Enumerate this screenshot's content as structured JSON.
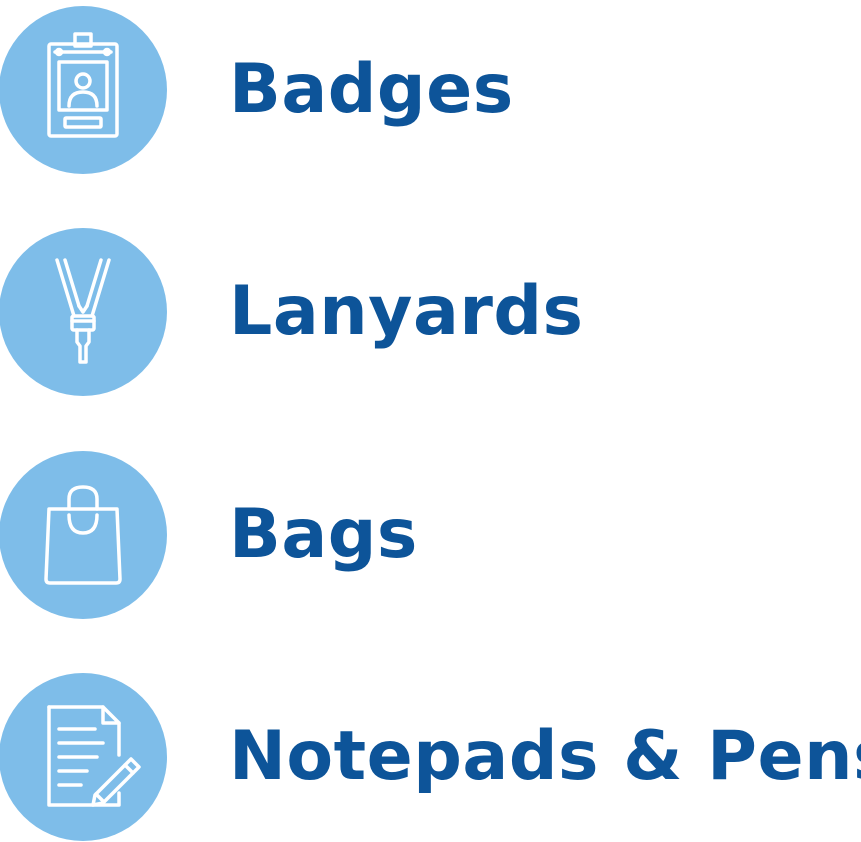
{
  "colors": {
    "circle": "#7ebde9",
    "icon_stroke": "#ffffff",
    "text": "#0d5499"
  },
  "items": [
    {
      "label": "Badges",
      "icon": "badge-icon"
    },
    {
      "label": "Lanyards",
      "icon": "lanyard-icon"
    },
    {
      "label": "Bags",
      "icon": "bag-icon"
    },
    {
      "label": "Notepads & Pens",
      "icon": "notepad-pen-icon"
    }
  ]
}
